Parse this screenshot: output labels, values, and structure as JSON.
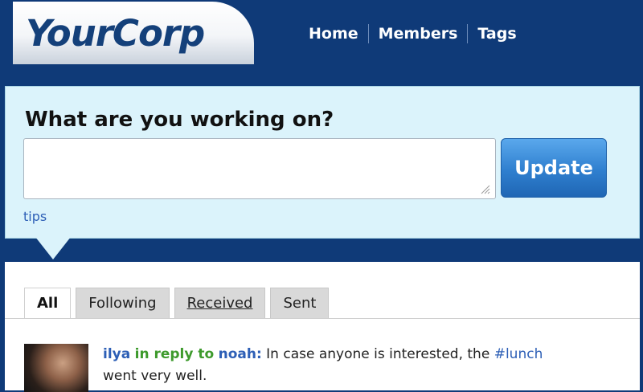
{
  "header": {
    "logo": "YourCorp",
    "nav": [
      {
        "label": "Home"
      },
      {
        "label": "Members"
      },
      {
        "label": "Tags"
      }
    ]
  },
  "status": {
    "prompt": "What are you working on?",
    "input_value": "",
    "update_label": "Update",
    "tips_label": "tips"
  },
  "timeline": {
    "tabs": [
      {
        "label": "All",
        "active": true
      },
      {
        "label": "Following",
        "active": false
      },
      {
        "label": "Received",
        "active": false
      },
      {
        "label": "Sent",
        "active": false
      }
    ],
    "entries": [
      {
        "user": "ilya",
        "relation": "in reply to",
        "target": "noah:",
        "text_before": " In case anyone is interested, the ",
        "hashtag": "#lunch",
        "text_after": "went very well."
      }
    ]
  },
  "colors": {
    "header_bg": "#0f3a78",
    "panel_bg": "#dbf3fb",
    "button": "#2f7fcf",
    "link": "#2d5fb6",
    "reply": "#3d9a2c"
  }
}
